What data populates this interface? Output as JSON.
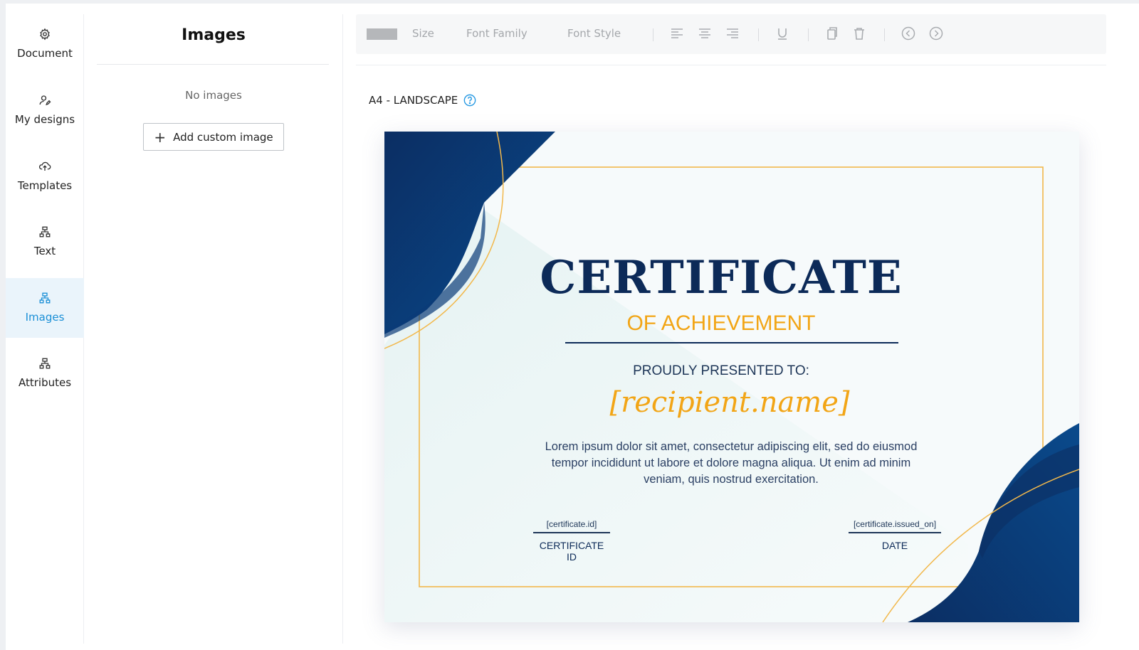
{
  "nav": {
    "items": [
      {
        "label": "Document",
        "icon": "gear-icon"
      },
      {
        "label": "My designs",
        "icon": "user-edit-icon"
      },
      {
        "label": "Templates",
        "icon": "cloud-upload-icon"
      },
      {
        "label": "Text",
        "icon": "sitemap-icon"
      },
      {
        "label": "Images",
        "icon": "sitemap-icon",
        "active": true
      },
      {
        "label": "Attributes",
        "icon": "sitemap-icon"
      }
    ]
  },
  "panel": {
    "title": "Images",
    "empty_text": "No images",
    "add_button_label": "Add custom image"
  },
  "toolbar": {
    "size_label": "Size",
    "font_family_label": "Font Family",
    "font_style_label": "Font Style"
  },
  "page": {
    "format_label": "A4 - LANDSCAPE"
  },
  "certificate": {
    "title": "CERTIFICATE",
    "subtitle": "OF ACHIEVEMENT",
    "presented": "PROUDLY PRESENTED TO:",
    "recipient": "[recipient.name]",
    "body": "Lorem ipsum dolor sit amet, consectetur adipiscing elit, sed do eiusmod tempor incididunt ut labore et dolore magna aliqua. Ut enim ad minim veniam, quis nostrud exercitation.",
    "id_value": "[certificate.id]",
    "id_caption": "CERTIFICATE ID",
    "date_value": "[certificate.issued_on]",
    "date_caption": "DATE"
  },
  "colors": {
    "accent": "#1a8fd6",
    "navy": "#0c2a58",
    "gold": "#f2a516"
  }
}
